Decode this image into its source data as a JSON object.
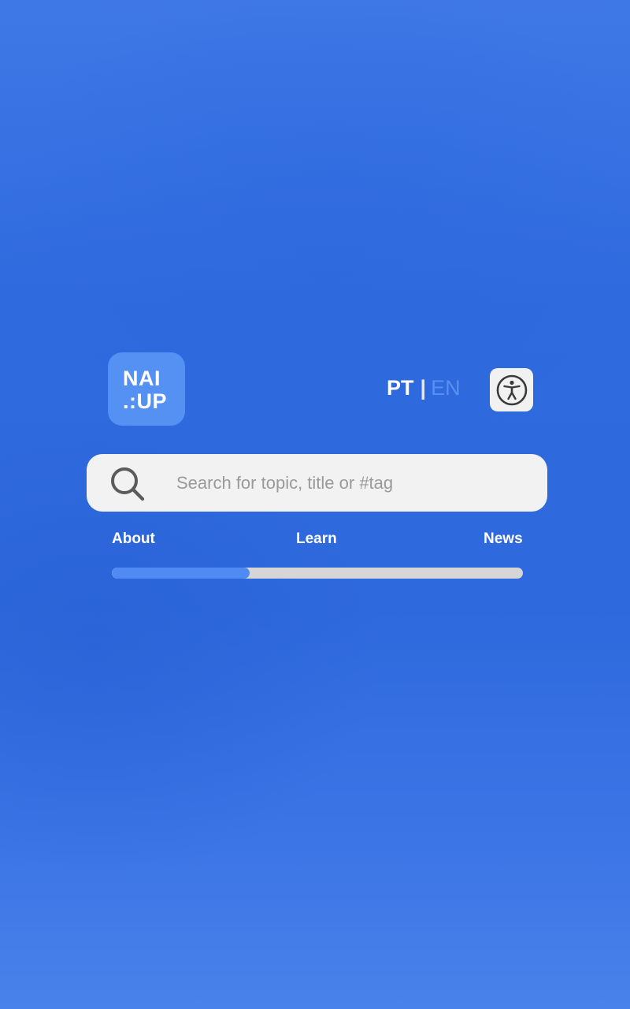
{
  "logo": {
    "line1": "NAI",
    "line2": ".:UP"
  },
  "language": {
    "active": "PT",
    "separator": "|",
    "inactive": "EN"
  },
  "accessibility_button": {
    "icon": "accessibility-icon"
  },
  "search": {
    "icon": "search-icon",
    "value": "",
    "placeholder": "Search for topic, title or #tag"
  },
  "nav": {
    "about": "About",
    "learn": "Learn",
    "news": "News"
  },
  "progress": {
    "fraction": 0.335
  },
  "colors": {
    "background": "#2e69dd",
    "logo_bg": "#5590f3",
    "progress_fill": "#4f8bf2",
    "progress_track": "#d6d6d6",
    "inactive_lang": "#5a8ff0"
  }
}
